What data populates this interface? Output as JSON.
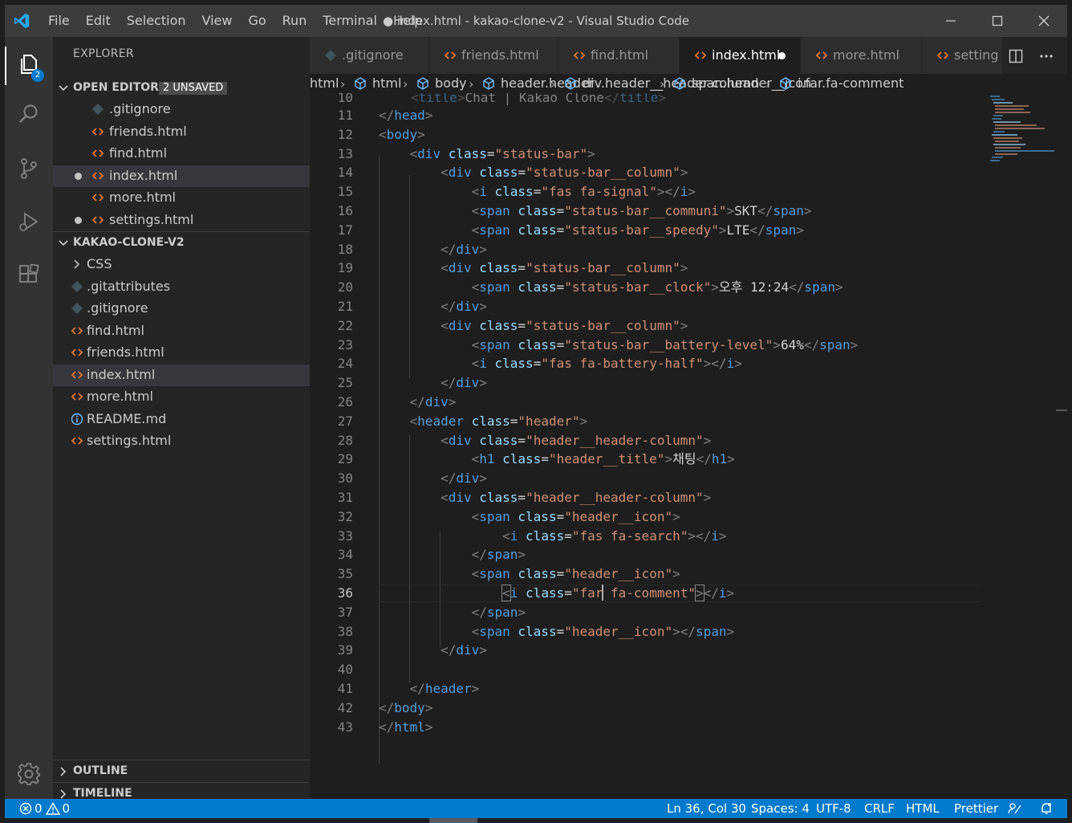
{
  "window": {
    "title": "● index.html - kakao-clone-v2 - Visual Studio Code",
    "menu": [
      "File",
      "Edit",
      "Selection",
      "View",
      "Go",
      "Run",
      "Terminal",
      "Help"
    ]
  },
  "activity_bar": {
    "explorer_badge": "2",
    "icons": [
      "files-icon",
      "search-icon",
      "source-control-icon",
      "run-debug-icon",
      "extensions-icon",
      "gear-icon"
    ]
  },
  "sidebar": {
    "title": "EXPLORER",
    "open_editors": {
      "label": "OPEN EDITORS",
      "badge": "2 UNSAVED",
      "items": [
        {
          "name": ".gitignore",
          "icon": "git-icon",
          "modified": false,
          "selected": false
        },
        {
          "name": "friends.html",
          "icon": "html-icon",
          "modified": false,
          "selected": false
        },
        {
          "name": "find.html",
          "icon": "html-icon",
          "modified": false,
          "selected": false
        },
        {
          "name": "index.html",
          "icon": "html-icon",
          "modified": true,
          "selected": true
        },
        {
          "name": "more.html",
          "icon": "html-icon",
          "modified": false,
          "selected": false
        },
        {
          "name": "settings.html",
          "icon": "html-icon",
          "modified": true,
          "selected": false
        }
      ]
    },
    "project": {
      "label": "KAKAO-CLONE-V2",
      "items": [
        {
          "name": "CSS",
          "icon": "chevron-right-icon",
          "selected": false
        },
        {
          "name": ".gitattributes",
          "icon": "git-icon",
          "selected": false
        },
        {
          "name": ".gitignore",
          "icon": "git-icon",
          "selected": false
        },
        {
          "name": "find.html",
          "icon": "html-icon",
          "selected": false
        },
        {
          "name": "friends.html",
          "icon": "html-icon",
          "selected": false
        },
        {
          "name": "index.html",
          "icon": "html-icon",
          "selected": true
        },
        {
          "name": "more.html",
          "icon": "html-icon",
          "selected": false
        },
        {
          "name": "README.md",
          "icon": "info-icon",
          "selected": false
        },
        {
          "name": "settings.html",
          "icon": "html-icon",
          "selected": false
        }
      ]
    },
    "outline_label": "OUTLINE",
    "timeline_label": "TIMELINE"
  },
  "tabs": [
    {
      "name": ".gitignore",
      "icon": "git-icon",
      "active": false,
      "modified": false
    },
    {
      "name": "friends.html",
      "icon": "html-icon",
      "active": false,
      "modified": false
    },
    {
      "name": "find.html",
      "icon": "html-icon",
      "active": false,
      "modified": false
    },
    {
      "name": "index.html",
      "icon": "html-icon",
      "active": true,
      "modified": true
    },
    {
      "name": "more.html",
      "icon": "html-icon",
      "active": false,
      "modified": false
    },
    {
      "name": "setting",
      "icon": "html-icon",
      "active": false,
      "modified": false
    }
  ],
  "breadcrumb": [
    "html",
    "html",
    "body",
    "header.header",
    "div.header__header-column",
    "span.header__icon",
    "i.far.fa-comment"
  ],
  "editor": {
    "partial_line": {
      "num": "10",
      "text": "<title>Chat | Kakao Clone</title>"
    },
    "lines": [
      {
        "num": "11",
        "text": "</head>"
      },
      {
        "num": "12",
        "text": "<body>"
      },
      {
        "num": "13",
        "text": "    <div class=\"status-bar\">"
      },
      {
        "num": "14",
        "text": "        <div class=\"status-bar__column\">"
      },
      {
        "num": "15",
        "text": "            <i class=\"fas fa-signal\"></i>"
      },
      {
        "num": "16",
        "text": "            <span class=\"status-bar__communi\">SKT</span>"
      },
      {
        "num": "17",
        "text": "            <span class=\"status-bar__speedy\">LTE</span>"
      },
      {
        "num": "18",
        "text": "        </div>"
      },
      {
        "num": "19",
        "text": "        <div class=\"status-bar__column\">"
      },
      {
        "num": "20",
        "text": "            <span class=\"status-bar__clock\">오후 12:24</span>"
      },
      {
        "num": "21",
        "text": "        </div>"
      },
      {
        "num": "22",
        "text": "        <div class=\"status-bar__column\">"
      },
      {
        "num": "23",
        "text": "            <span class=\"status-bar__battery-level\">64%</span>"
      },
      {
        "num": "24",
        "text": "            <i class=\"fas fa-battery-half\"></i>"
      },
      {
        "num": "25",
        "text": "        </div>"
      },
      {
        "num": "26",
        "text": "    </div>"
      },
      {
        "num": "27",
        "text": "    <header class=\"header\">"
      },
      {
        "num": "28",
        "text": "        <div class=\"header__header-column\">"
      },
      {
        "num": "29",
        "text": "            <h1 class=\"header__title\">채팅</h1>"
      },
      {
        "num": "30",
        "text": "        </div>"
      },
      {
        "num": "31",
        "text": "        <div class=\"header__header-column\">"
      },
      {
        "num": "32",
        "text": "            <span class=\"header__icon\">"
      },
      {
        "num": "33",
        "text": "                <i class=\"fas fa-search\"></i>"
      },
      {
        "num": "34",
        "text": "            </span>"
      },
      {
        "num": "35",
        "text": "            <span class=\"header__icon\">"
      },
      {
        "num": "36",
        "text": "                <i class=\"far fa-comment\"></i>"
      },
      {
        "num": "37",
        "text": "            </span>"
      },
      {
        "num": "38",
        "text": "            <span class=\"header__icon\"></span>"
      },
      {
        "num": "39",
        "text": "        </div>"
      },
      {
        "num": "40",
        "text": ""
      },
      {
        "num": "41",
        "text": "    </header>"
      },
      {
        "num": "42",
        "text": "</body>"
      },
      {
        "num": "43",
        "text": "</html>"
      }
    ]
  },
  "status_bar": {
    "errors": "0",
    "warnings": "0",
    "position": "Ln 36, Col 30",
    "spaces": "Spaces: 4",
    "encoding": "UTF-8",
    "eol": "CRLF",
    "language": "HTML",
    "formatter": "Prettier"
  },
  "colors": {
    "accent": "#007acc",
    "tag": "#569cd6",
    "attribute": "#9cdcfe",
    "string": "#ce9178",
    "html_icon": "#e37933",
    "git_icon": "#41535b"
  }
}
